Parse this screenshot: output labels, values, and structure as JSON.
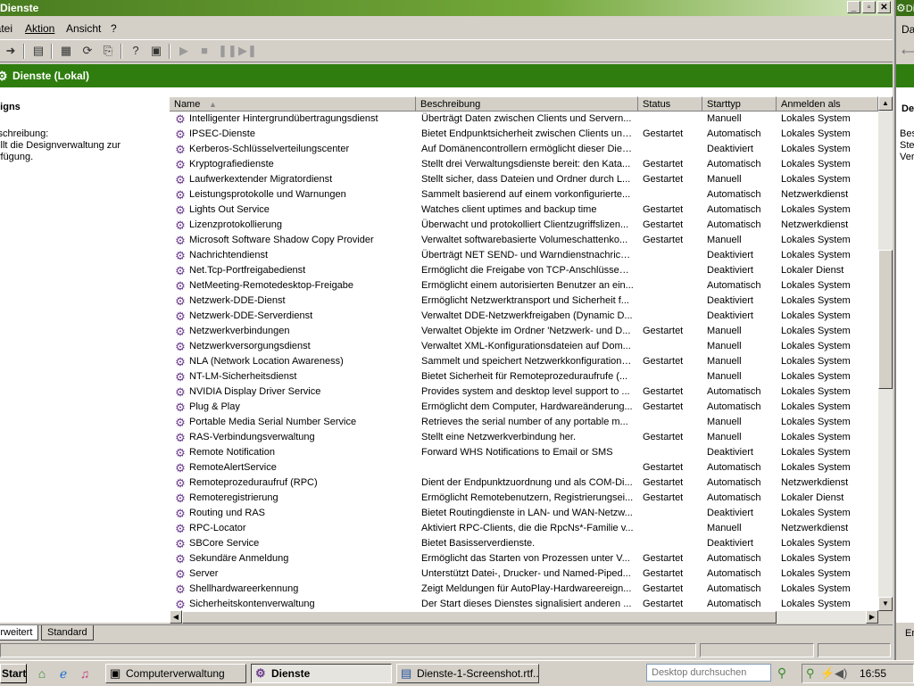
{
  "window": {
    "title": "Dienste",
    "buttons": [
      "_",
      "▫",
      "✕"
    ]
  },
  "menu": [
    "Datei",
    "Aktion",
    "Ansicht",
    "?"
  ],
  "green_header": "Dienste (Lokal)",
  "left_pane": {
    "heading": "Designs",
    "description": "Beschreibung:\nStellt die Designverwaltung zur Verfügung."
  },
  "columns": [
    "Name",
    "Beschreibung",
    "Status",
    "Starttyp",
    "Anmelden als"
  ],
  "services": [
    [
      "Intelligenter Hintergrundübertragungsdienst",
      "Überträgt Daten zwischen Clients und Servern...",
      "",
      "Manuell",
      "Lokales System"
    ],
    [
      "IPSEC-Dienste",
      "Bietet Endpunktsicherheit zwischen Clients und...",
      "Gestartet",
      "Automatisch",
      "Lokales System"
    ],
    [
      "Kerberos-Schlüsselverteilungscenter",
      "Auf Domänencontrollern ermöglicht dieser Dien...",
      "",
      "Deaktiviert",
      "Lokales System"
    ],
    [
      "Kryptografiedienste",
      "Stellt drei Verwaltungsdienste bereit: den Kata...",
      "Gestartet",
      "Automatisch",
      "Lokales System"
    ],
    [
      "Laufwerkextender Migratordienst",
      "Stellt sicher, dass Dateien und Ordner durch L...",
      "Gestartet",
      "Manuell",
      "Lokales System"
    ],
    [
      "Leistungsprotokolle und Warnungen",
      "Sammelt basierend auf einem vorkonfigurierte...",
      "",
      "Automatisch",
      "Netzwerkdienst"
    ],
    [
      "Lights Out Service",
      "Watches client uptimes and backup time",
      "Gestartet",
      "Automatisch",
      "Lokales System"
    ],
    [
      "Lizenzprotokollierung",
      "Überwacht und protokolliert Clientzugriffslizen...",
      "Gestartet",
      "Automatisch",
      "Netzwerkdienst"
    ],
    [
      "Microsoft Software Shadow Copy Provider",
      "Verwaltet softwarebasierte Volumeschattenko...",
      "Gestartet",
      "Manuell",
      "Lokales System"
    ],
    [
      "Nachrichtendienst",
      "Überträgt NET SEND- und Warndienstnachrich...",
      "",
      "Deaktiviert",
      "Lokales System"
    ],
    [
      "Net.Tcp-Portfreigabedienst",
      "Ermöglicht die Freigabe von TCP-Anschlüssen ...",
      "",
      "Deaktiviert",
      "Lokaler Dienst"
    ],
    [
      "NetMeeting-Remotedesktop-Freigabe",
      "Ermöglicht einem autorisierten Benutzer an ein...",
      "",
      "Automatisch",
      "Lokales System"
    ],
    [
      "Netzwerk-DDE-Dienst",
      "Ermöglicht Netzwerktransport und Sicherheit f...",
      "",
      "Deaktiviert",
      "Lokales System"
    ],
    [
      "Netzwerk-DDE-Serverdienst",
      "Verwaltet  DDE-Netzwerkfreigaben (Dynamic D...",
      "",
      "Deaktiviert",
      "Lokales System"
    ],
    [
      "Netzwerkverbindungen",
      "Verwaltet Objekte im Ordner 'Netzwerk- und D...",
      "Gestartet",
      "Manuell",
      "Lokales System"
    ],
    [
      "Netzwerkversorgungsdienst",
      "Verwaltet XML-Konfigurationsdateien auf Dom...",
      "",
      "Manuell",
      "Lokales System"
    ],
    [
      "NLA (Network Location Awareness)",
      "Sammelt und speichert Netzwerkkonfigurations...",
      "Gestartet",
      "Manuell",
      "Lokales System"
    ],
    [
      "NT-LM-Sicherheitsdienst",
      "Bietet Sicherheit für Remoteprozeduraufrufe (...",
      "",
      "Manuell",
      "Lokales System"
    ],
    [
      "NVIDIA Display Driver Service",
      "Provides system and desktop level support to ...",
      "Gestartet",
      "Automatisch",
      "Lokales System"
    ],
    [
      "Plug & Play",
      "Ermöglicht dem Computer, Hardwareänderung...",
      "Gestartet",
      "Automatisch",
      "Lokales System"
    ],
    [
      "Portable Media Serial Number Service",
      "Retrieves the serial number of any portable m...",
      "",
      "Manuell",
      "Lokales System"
    ],
    [
      "RAS-Verbindungsverwaltung",
      "Stellt eine Netzwerkverbindung her.",
      "Gestartet",
      "Manuell",
      "Lokales System"
    ],
    [
      "Remote Notification",
      "Forward WHS Notifications to Email or SMS",
      "",
      "Deaktiviert",
      "Lokales System"
    ],
    [
      "RemoteAlertService",
      "",
      "Gestartet",
      "Automatisch",
      "Lokales System"
    ],
    [
      "Remoteprozeduraufruf (RPC)",
      "Dient der Endpunktzuordnung und als COM-Di...",
      "Gestartet",
      "Automatisch",
      "Netzwerkdienst"
    ],
    [
      "Remoteregistrierung",
      "Ermöglicht Remotebenutzern, Registrierungsei...",
      "Gestartet",
      "Automatisch",
      "Lokaler Dienst"
    ],
    [
      "Routing und RAS",
      "Bietet Routingdienste in LAN- und WAN-Netzw...",
      "",
      "Deaktiviert",
      "Lokales System"
    ],
    [
      "RPC-Locator",
      "Aktiviert RPC-Clients, die die RpcNs*-Familie v...",
      "",
      "Manuell",
      "Netzwerkdienst"
    ],
    [
      "SBCore Service",
      "Bietet Basisserverdienste.",
      "",
      "Deaktiviert",
      "Lokales System"
    ],
    [
      "Sekundäre Anmeldung",
      "Ermöglicht das Starten von Prozessen unter V...",
      "Gestartet",
      "Automatisch",
      "Lokales System"
    ],
    [
      "Server",
      "Unterstützt Datei-, Drucker- und Named-Piped...",
      "Gestartet",
      "Automatisch",
      "Lokales System"
    ],
    [
      "Shellhardwareerkennung",
      "Zeigt Meldungen für AutoPlay-Hardwareereign...",
      "Gestartet",
      "Automatisch",
      "Lokales System"
    ],
    [
      "Sicherheitskontenverwaltung",
      "Der Start dieses Dienstes signalisiert anderen ...",
      "Gestartet",
      "Automatisch",
      "Lokales System"
    ]
  ],
  "tabs": [
    "Erweitert",
    "Standard"
  ],
  "right_window": {
    "title": "Dienste",
    "menu_fragment": "Da",
    "pane_heading": "Des",
    "pane_lines": [
      "Bes",
      "Stel",
      "Ver"
    ],
    "tab_fragment": "Er"
  },
  "taskbar": {
    "start": "Start",
    "tasks": [
      "Computerverwaltung",
      "Dienste",
      "Dienste-1-Screenshot.rtf..."
    ],
    "search_placeholder": "Desktop durchsuchen",
    "clock": "16:55"
  }
}
